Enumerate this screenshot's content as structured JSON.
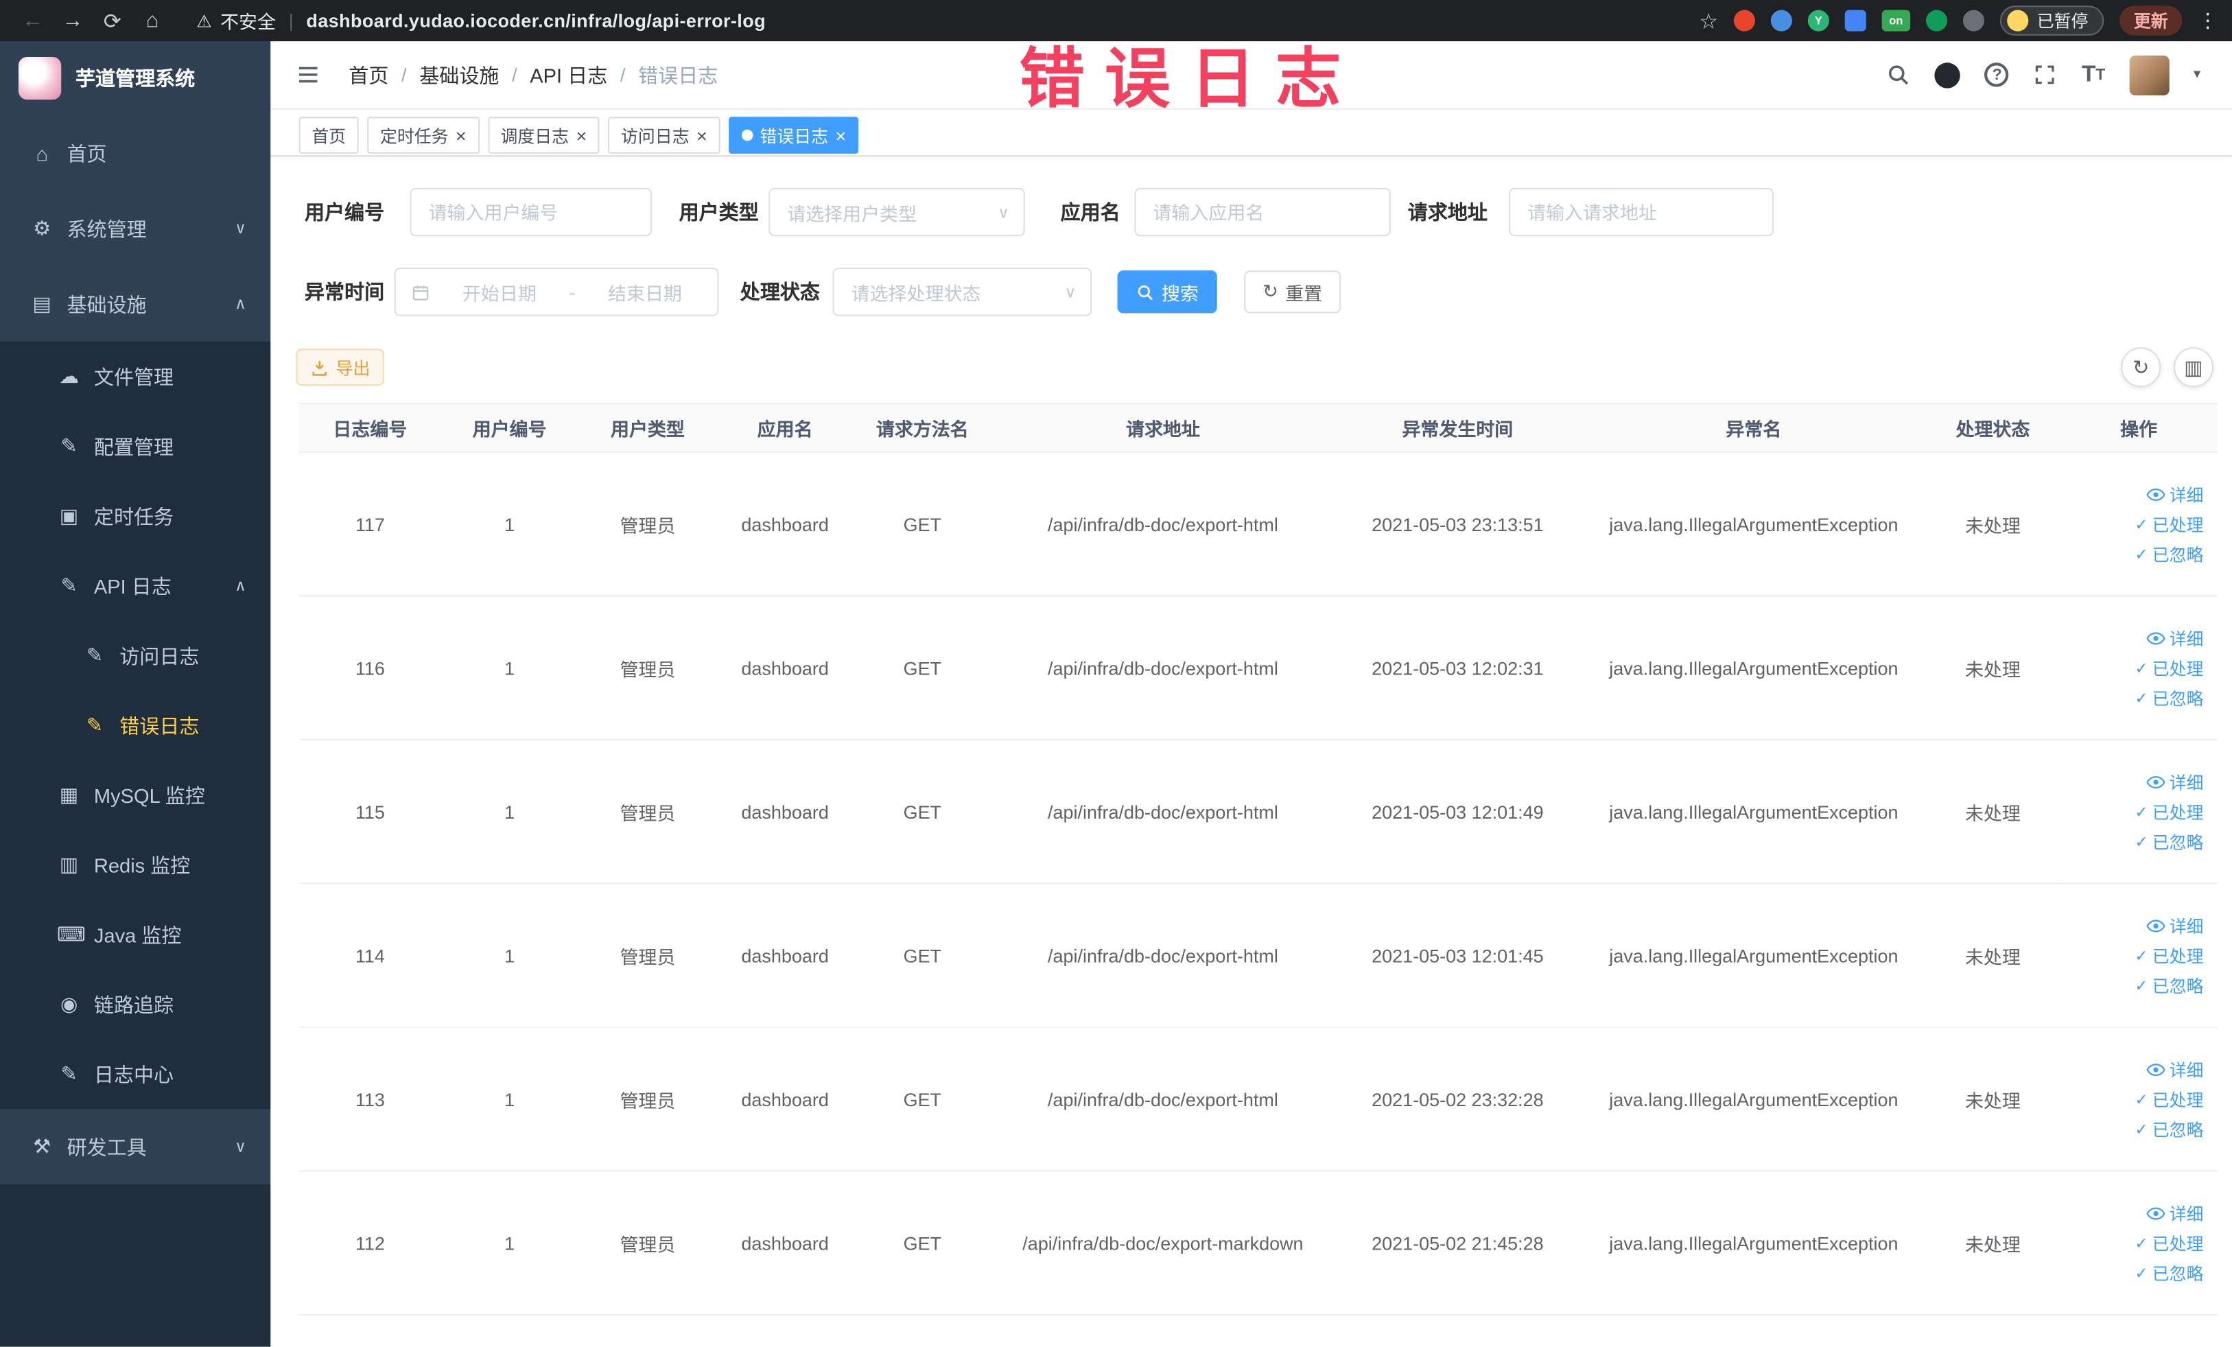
{
  "browser": {
    "security": "不安全",
    "url": "dashboard.yudao.iocoder.cn/infra/log/api-error-log",
    "paused_label": "已暂停",
    "update_label": "更新"
  },
  "annotation": "错误日志",
  "sidebar": {
    "title": "芋道管理系统",
    "items": [
      {
        "label": "首页"
      },
      {
        "label": "系统管理"
      },
      {
        "label": "基础设施"
      },
      {
        "label": "文件管理"
      },
      {
        "label": "配置管理"
      },
      {
        "label": "定时任务"
      },
      {
        "label": "API 日志"
      },
      {
        "label": "访问日志"
      },
      {
        "label": "错误日志"
      },
      {
        "label": "MySQL 监控"
      },
      {
        "label": "Redis 监控"
      },
      {
        "label": "Java 监控"
      },
      {
        "label": "链路追踪"
      },
      {
        "label": "日志中心"
      },
      {
        "label": "研发工具"
      }
    ]
  },
  "breadcrumb": {
    "items": [
      "首页",
      "基础设施",
      "API 日志",
      "错误日志"
    ]
  },
  "tabs": {
    "items": [
      {
        "label": "首页"
      },
      {
        "label": "定时任务"
      },
      {
        "label": "调度日志"
      },
      {
        "label": "访问日志"
      },
      {
        "label": "错误日志"
      }
    ]
  },
  "filters": {
    "user_id_label": "用户编号",
    "user_id_placeholder": "请输入用户编号",
    "user_type_label": "用户类型",
    "user_type_placeholder": "请选择用户类型",
    "app_name_label": "应用名",
    "app_name_placeholder": "请输入应用名",
    "request_url_label": "请求地址",
    "request_url_placeholder": "请输入请求地址",
    "time_label": "异常时间",
    "time_start_placeholder": "开始日期",
    "time_separator": "-",
    "time_end_placeholder": "结束日期",
    "status_label": "处理状态",
    "status_placeholder": "请选择处理状态",
    "search_label": "搜索",
    "reset_label": "重置"
  },
  "toolbar": {
    "export_label": "导出"
  },
  "table": {
    "columns": [
      "日志编号",
      "用户编号",
      "用户类型",
      "应用名",
      "请求方法名",
      "请求地址",
      "异常发生时间",
      "异常名",
      "处理状态",
      "操作"
    ],
    "action_detail": "详细",
    "action_processed": "已处理",
    "action_ignored": "已忽略",
    "rows": [
      {
        "id": "117",
        "user_id": "1",
        "user_type": "管理员",
        "app": "dashboard",
        "method": "GET",
        "url": "/api/infra/db-doc/export-html",
        "time": "2021-05-03 23:13:51",
        "exception": "java.lang.IllegalArgumentException",
        "status": "未处理"
      },
      {
        "id": "116",
        "user_id": "1",
        "user_type": "管理员",
        "app": "dashboard",
        "method": "GET",
        "url": "/api/infra/db-doc/export-html",
        "time": "2021-05-03 12:02:31",
        "exception": "java.lang.IllegalArgumentException",
        "status": "未处理"
      },
      {
        "id": "115",
        "user_id": "1",
        "user_type": "管理员",
        "app": "dashboard",
        "method": "GET",
        "url": "/api/infra/db-doc/export-html",
        "time": "2021-05-03 12:01:49",
        "exception": "java.lang.IllegalArgumentException",
        "status": "未处理"
      },
      {
        "id": "114",
        "user_id": "1",
        "user_type": "管理员",
        "app": "dashboard",
        "method": "GET",
        "url": "/api/infra/db-doc/export-html",
        "time": "2021-05-03 12:01:45",
        "exception": "java.lang.IllegalArgumentException",
        "status": "未处理"
      },
      {
        "id": "113",
        "user_id": "1",
        "user_type": "管理员",
        "app": "dashboard",
        "method": "GET",
        "url": "/api/infra/db-doc/export-html",
        "time": "2021-05-02 23:32:28",
        "exception": "java.lang.IllegalArgumentException",
        "status": "未处理"
      },
      {
        "id": "112",
        "user_id": "1",
        "user_type": "管理员",
        "app": "dashboard",
        "method": "GET",
        "url": "/api/infra/db-doc/export-markdown",
        "time": "2021-05-02 21:45:28",
        "exception": "java.lang.IllegalArgumentException",
        "status": "未处理"
      }
    ]
  }
}
